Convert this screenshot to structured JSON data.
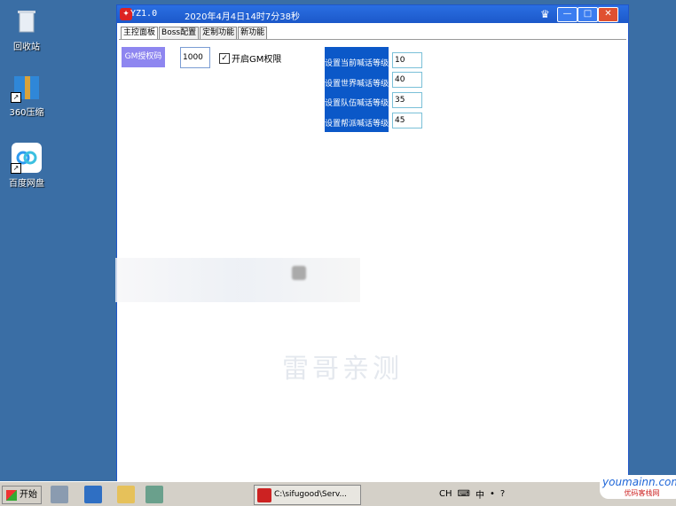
{
  "desktop": {
    "icons": [
      {
        "label": "回收站",
        "icon": "recycle-bin-icon"
      },
      {
        "label": "360压缩",
        "icon": "archive-icon"
      },
      {
        "label": "百度网盘",
        "icon": "cloud-drive-icon"
      }
    ]
  },
  "window": {
    "title": "YZ1.0",
    "datetime": "2020年4月4日14时7分38秒",
    "controls": {
      "min": "—",
      "max": "□",
      "close": "✕"
    }
  },
  "tabs": [
    "主控面板",
    "Boss配置",
    "定制功能",
    "新功能"
  ],
  "gm": {
    "label": "GM授权码",
    "value": "1000",
    "checkbox_label": "开启GM权限",
    "checked": true
  },
  "levels": [
    {
      "label": "设置当前喊话等级",
      "value": "10"
    },
    {
      "label": "设置世界喊话等级",
      "value": "40"
    },
    {
      "label": "设置队伍喊话等级",
      "value": "35"
    },
    {
      "label": "设置帮派喊话等级",
      "value": "45"
    }
  ],
  "watermark": "雷哥亲测",
  "taskbar": {
    "start_label": "开始",
    "task_title": "C:\\sifugood\\Serv...",
    "tray": [
      "CH",
      "中",
      "•",
      "?"
    ]
  },
  "brand": {
    "text": "youmainn.com",
    "sub": "优码客栈网"
  },
  "colors": {
    "window_title": "#1c58c9",
    "level_panel": "#0b58c8",
    "gm_label": "#8e86f0"
  }
}
